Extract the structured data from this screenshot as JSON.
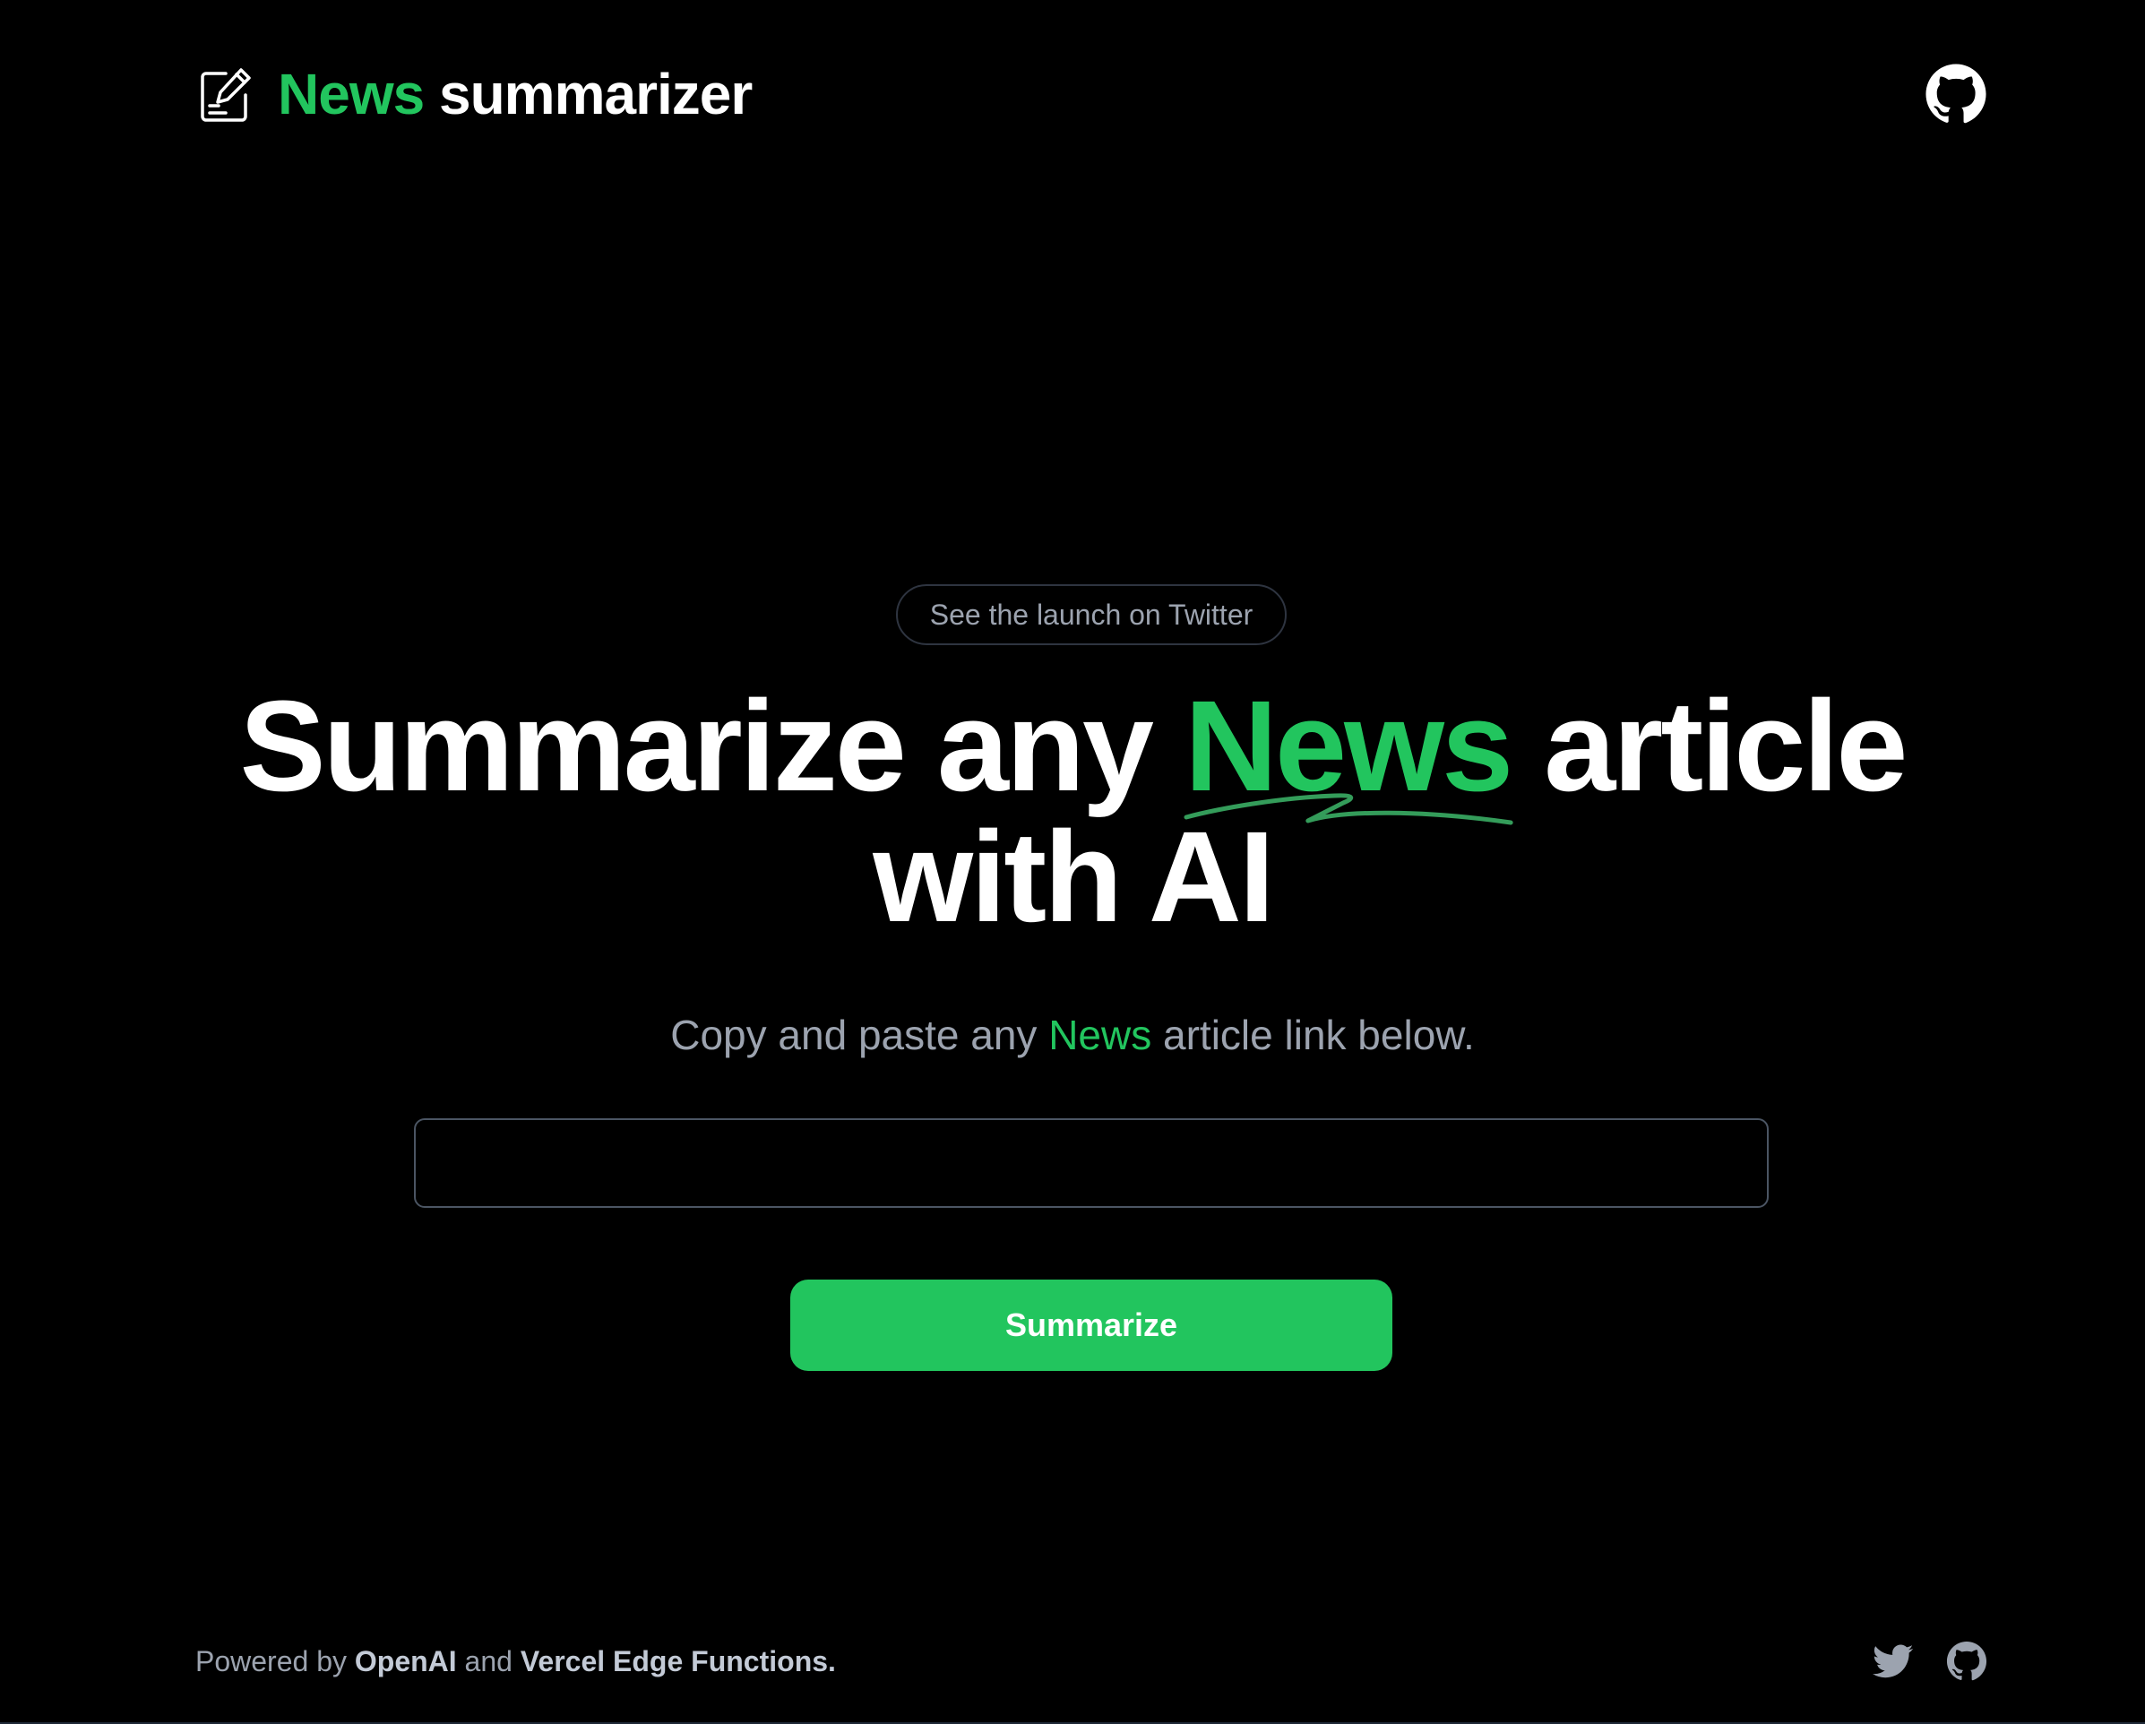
{
  "header": {
    "brand_accent": "News",
    "brand_rest": " summarizer",
    "brand_icon": "edit-note-icon",
    "github_icon": "github-icon"
  },
  "main": {
    "announcement": "See the launch on Twitter",
    "headline_before": "Summarize any ",
    "headline_accent": "News",
    "headline_after": " article with AI",
    "subtitle_before": "Copy and paste any ",
    "subtitle_accent": "News",
    "subtitle_after": " article link below.",
    "input_value": "",
    "button_label": "Summarize"
  },
  "footer": {
    "powered_by": "Powered by ",
    "openai": "OpenAI",
    "and": " and ",
    "vercel": "Vercel Edge Functions.",
    "twitter_icon": "twitter-icon",
    "github_icon": "github-icon"
  },
  "colors": {
    "background": "#000000",
    "accent": "#22c55e",
    "muted_text": "#9ca3af",
    "text": "#ffffff"
  }
}
